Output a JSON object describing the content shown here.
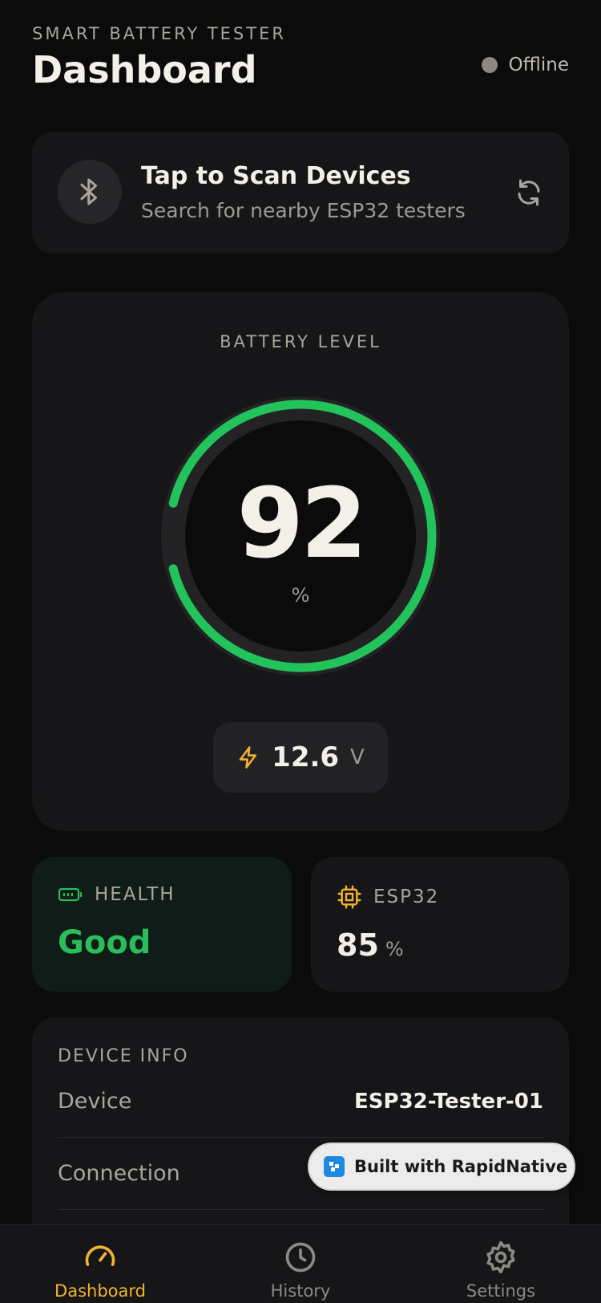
{
  "header": {
    "kicker": "SMART BATTERY TESTER",
    "title": "Dashboard",
    "status": "Offline",
    "status_color": "#8c8983"
  },
  "scan": {
    "title": "Tap to Scan Devices",
    "subtitle": "Search for nearby ESP32 testers"
  },
  "battery": {
    "label": "BATTERY LEVEL",
    "level": "92",
    "level_fraction": 0.92,
    "unit": "%",
    "voltage": "12.6",
    "voltage_unit": "V",
    "accent_color": "#22c35a"
  },
  "stats": {
    "health_label": "HEALTH",
    "health_value": "Good",
    "esp_label": "ESP32",
    "esp_value": "85",
    "esp_unit": "%"
  },
  "device_info": {
    "title": "DEVICE INFO",
    "rows": [
      {
        "key": "Device",
        "value": "ESP32-Tester-01"
      },
      {
        "key": "Connection",
        "value": ""
      }
    ]
  },
  "badge": {
    "text": "Built with RapidNative"
  },
  "nav": {
    "items": [
      {
        "label": "Dashboard",
        "active": true
      },
      {
        "label": "History",
        "active": false
      },
      {
        "label": "Settings",
        "active": false
      }
    ],
    "active_color": "#f4b32e",
    "inactive_color": "#8c8983"
  }
}
